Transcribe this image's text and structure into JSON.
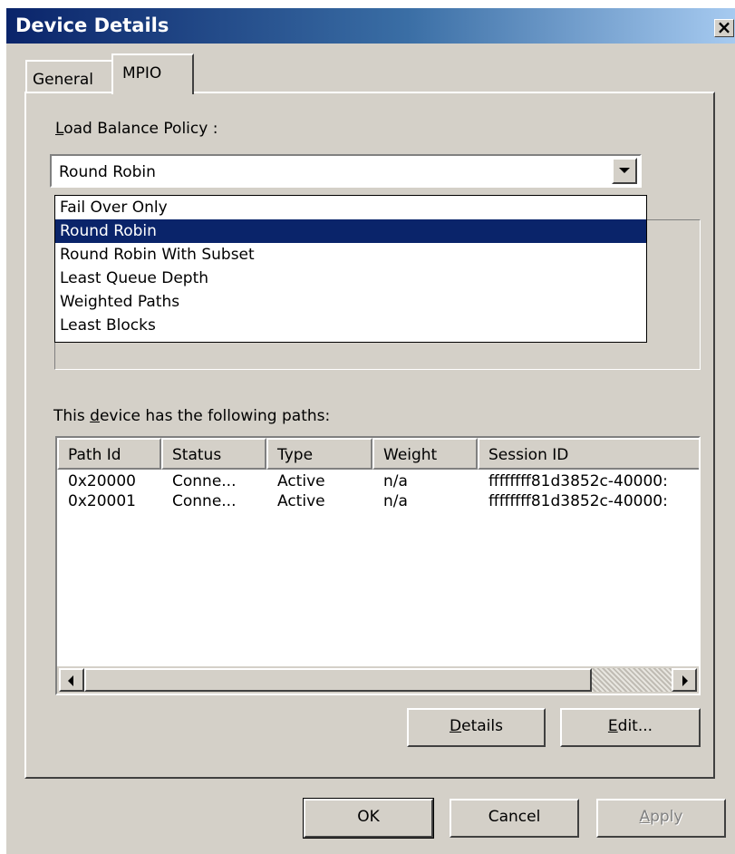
{
  "window": {
    "title": "Device Details",
    "close_label": "×"
  },
  "tabs": [
    {
      "label": "General"
    },
    {
      "label": "MPIO"
    }
  ],
  "policy": {
    "label_accel": "L",
    "label_rest": "oad Balance Policy :",
    "selected": "Round Robin",
    "options": [
      "Fail Over Only",
      "Round Robin",
      "Round Robin With Subset",
      "Least Queue Depth",
      "Weighted Paths",
      "Least Blocks"
    ],
    "highlighted_index": 1
  },
  "paths": {
    "label_pre": "This ",
    "label_accel": "d",
    "label_post": "evice has the following paths:",
    "columns": [
      "Path Id",
      "Status",
      "Type",
      "Weight",
      "Session ID"
    ],
    "rows": [
      [
        "0x20000",
        "Conne...",
        "Active",
        "n/a",
        "ffffffff81d3852c-40000:"
      ],
      [
        "0x20001",
        "Conne...",
        "Active",
        "n/a",
        "ffffffff81d3852c-40000:"
      ]
    ]
  },
  "buttons": {
    "details_accel": "D",
    "details_rest": "etails",
    "edit_accel": "E",
    "edit_rest": "dit...",
    "ok": "OK",
    "cancel": "Cancel",
    "apply_accel": "A",
    "apply_rest": "pply"
  },
  "colors": {
    "titlebar": "#0a246a",
    "selection": "#0a246a",
    "face": "#d4d0c8"
  }
}
